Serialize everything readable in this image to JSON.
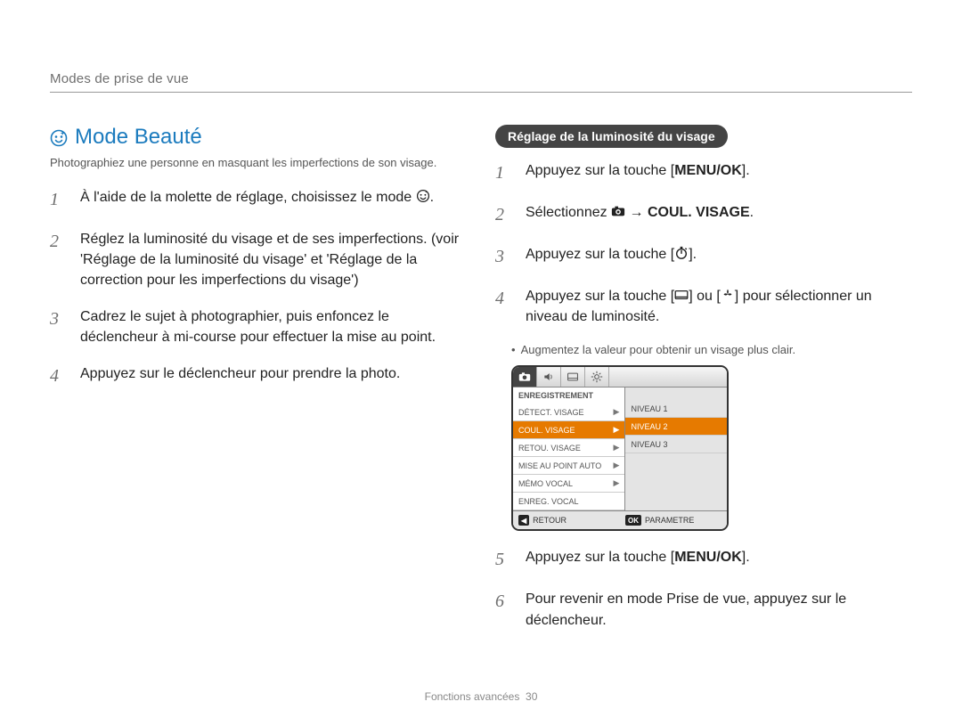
{
  "top": {
    "breadcrumb": "Modes de prise de vue"
  },
  "title": "Mode Beauté",
  "intro": "Photographiez une personne en masquant les imperfections de son visage.",
  "left_steps": [
    {
      "n": "1",
      "text": "À l'aide de la molette de réglage, choisissez le mode",
      "has_beauty_icon_after": true,
      "trailing": "."
    },
    {
      "n": "2",
      "text": "Réglez la luminosité du visage et de ses imperfections. (voir 'Réglage de la luminosité du visage' et 'Réglage de la correction pour les imperfections du visage')"
    },
    {
      "n": "3",
      "text": "Cadrez le sujet à photographier, puis enfoncez le déclencheur à mi-course pour effectuer la mise au point."
    },
    {
      "n": "4",
      "text": "Appuyez sur le déclencheur pour prendre la photo."
    }
  ],
  "right": {
    "pill": "Réglage de la luminosité du visage",
    "steps": [
      {
        "n": "1",
        "pre": "Appuyez sur la touche [",
        "bold": "MENU/OK",
        "post": "]."
      },
      {
        "n": "2",
        "pre": "Sélectionnez ",
        "icon": "camera",
        "arrow": " → ",
        "bold": "COUL. VISAGE",
        "post": "."
      },
      {
        "n": "3",
        "pre": "Appuyez sur la touche [",
        "icon": "timer",
        "post": "]."
      },
      {
        "n": "4",
        "pre": "Appuyez sur la touche [",
        "icon": "display",
        "mid": "] ou [",
        "icon2": "macro",
        "post": "] pour sélectionner un niveau de luminosité."
      },
      {
        "n": "5",
        "pre": "Appuyez sur la touche [",
        "bold": "MENU/OK",
        "post": "]."
      },
      {
        "n": "6",
        "text": "Pour revenir en mode Prise de vue, appuyez sur le déclencheur."
      }
    ],
    "note": "Augmentez la valeur pour obtenir un visage plus clair."
  },
  "menu": {
    "heading": "ENREGISTREMENT",
    "left_rows": [
      {
        "label": "DÉTECT. VISAGE",
        "arrow": true,
        "sel": false
      },
      {
        "label": "COUL. VISAGE",
        "arrow": true,
        "sel": true
      },
      {
        "label": "RETOU. VISAGE",
        "arrow": true,
        "sel": false
      },
      {
        "label": "MISE AU POINT AUTO",
        "arrow": true,
        "sel": false
      },
      {
        "label": "MÉMO VOCAL",
        "arrow": true,
        "sel": false
      },
      {
        "label": "ENREG. VOCAL",
        "arrow": false,
        "sel": false
      }
    ],
    "right_rows": [
      {
        "label": "NIVEAU 1",
        "hl": false
      },
      {
        "label": "NIVEAU 2",
        "hl": true
      },
      {
        "label": "NIVEAU 3",
        "hl": false
      }
    ],
    "foot_left_key": "◀",
    "foot_left": "RETOUR",
    "foot_right_key": "OK",
    "foot_right": "PARAMETRE"
  },
  "footer": {
    "section": "Fonctions avancées",
    "page": "30"
  }
}
